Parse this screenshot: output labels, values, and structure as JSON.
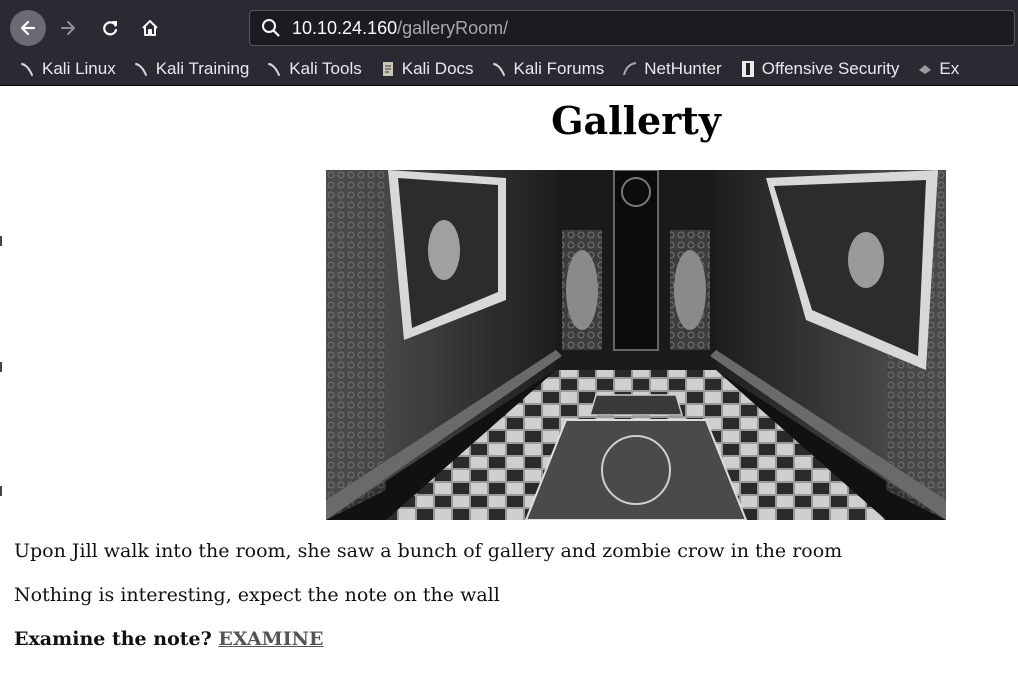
{
  "browser": {
    "url_host": "10.10.24.160",
    "url_path": "/galleryRoom/",
    "bookmarks": [
      {
        "label": "Kali Linux",
        "icon": "kali-dragon-icon"
      },
      {
        "label": "Kali Training",
        "icon": "kali-dragon-icon"
      },
      {
        "label": "Kali Tools",
        "icon": "kali-dragon-icon"
      },
      {
        "label": "Kali Docs",
        "icon": "docs-icon"
      },
      {
        "label": "Kali Forums",
        "icon": "kali-dragon-icon"
      },
      {
        "label": "NetHunter",
        "icon": "nethunter-icon"
      },
      {
        "label": "Offensive Security",
        "icon": "offsec-icon"
      },
      {
        "label": "Ex",
        "icon": "exploit-db-icon"
      }
    ]
  },
  "page": {
    "title": "Gallerty",
    "paragraph1": "Upon Jill walk into the room, she saw a bunch of gallery and zombie crow in the room",
    "paragraph2": "Nothing is interesting, expect the note on the wall",
    "question": "Examine the note?",
    "link_label": "EXAMINE"
  },
  "colors": {
    "chrome_bg": "#2b2a33",
    "urlbar_bg": "#1c1b22",
    "link": "#555555"
  }
}
